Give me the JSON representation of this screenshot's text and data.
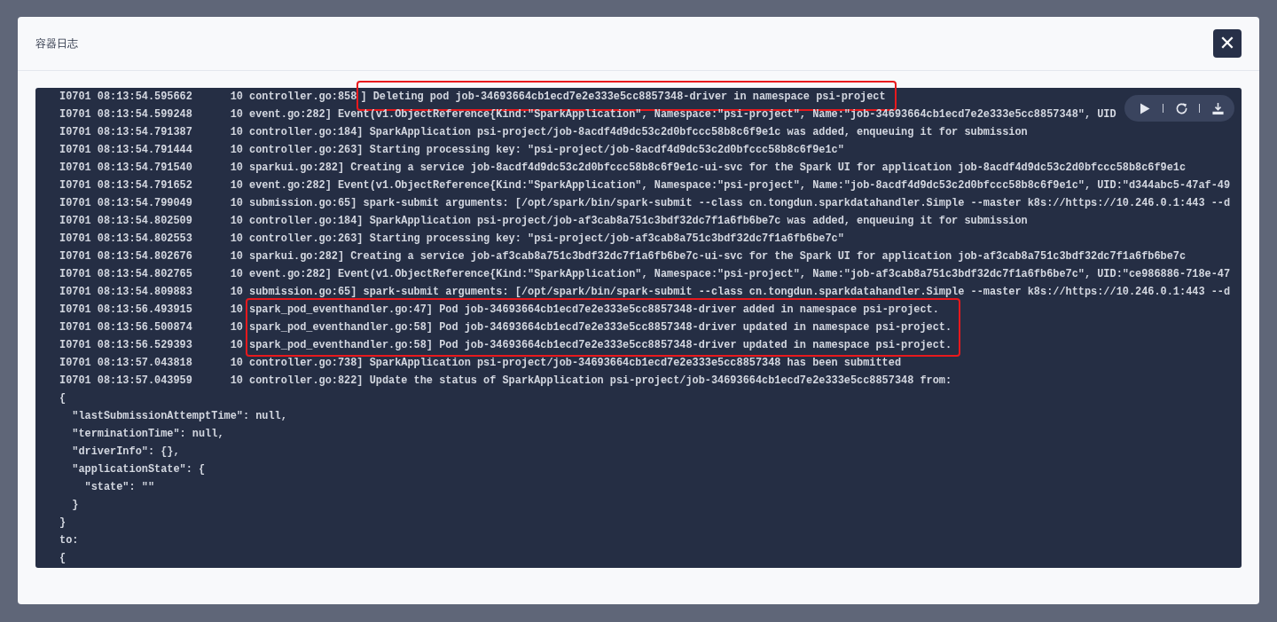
{
  "dialog": {
    "title": "容器日志",
    "close_label": "✕"
  },
  "log": [
    {
      "kind": "marked_line",
      "prefix": "I0701 08:13:54.595662      10 controller.go:858",
      "marked": "] Deleting pod job-34693664cb1ecd7e2e333e5cc8857348-driver in namespace psi-project"
    },
    {
      "kind": "line",
      "text": "I0701 08:13:54.599248      10 event.go:282] Event(v1.ObjectReference{Kind:\"SparkApplication\", Namespace:\"psi-project\", Name:\"job-34693664cb1ecd7e2e333e5cc8857348\", UID"
    },
    {
      "kind": "line",
      "text": "I0701 08:13:54.791387      10 controller.go:184] SparkApplication psi-project/job-8acdf4d9dc53c2d0bfccc58b8c6f9e1c was added, enqueuing it for submission"
    },
    {
      "kind": "line",
      "text": "I0701 08:13:54.791444      10 controller.go:263] Starting processing key: \"psi-project/job-8acdf4d9dc53c2d0bfccc58b8c6f9e1c\""
    },
    {
      "kind": "line",
      "text": "I0701 08:13:54.791540      10 sparkui.go:282] Creating a service job-8acdf4d9dc53c2d0bfccc58b8c6f9e1c-ui-svc for the Spark UI for application job-8acdf4d9dc53c2d0bfccc58b8c6f9e1c"
    },
    {
      "kind": "line",
      "text": "I0701 08:13:54.791652      10 event.go:282] Event(v1.ObjectReference{Kind:\"SparkApplication\", Namespace:\"psi-project\", Name:\"job-8acdf4d9dc53c2d0bfccc58b8c6f9e1c\", UID:\"d344abc5-47af-49"
    },
    {
      "kind": "line",
      "text": "I0701 08:13:54.799049      10 submission.go:65] spark-submit arguments: [/opt/spark/bin/spark-submit --class cn.tongdun.sparkdatahandler.Simple --master k8s://https://10.246.0.1:443 --d"
    },
    {
      "kind": "line",
      "text": "I0701 08:13:54.802509      10 controller.go:184] SparkApplication psi-project/job-af3cab8a751c3bdf32dc7f1a6fb6be7c was added, enqueuing it for submission"
    },
    {
      "kind": "line",
      "text": "I0701 08:13:54.802553      10 controller.go:263] Starting processing key: \"psi-project/job-af3cab8a751c3bdf32dc7f1a6fb6be7c\""
    },
    {
      "kind": "line",
      "text": "I0701 08:13:54.802676      10 sparkui.go:282] Creating a service job-af3cab8a751c3bdf32dc7f1a6fb6be7c-ui-svc for the Spark UI for application job-af3cab8a751c3bdf32dc7f1a6fb6be7c"
    },
    {
      "kind": "line",
      "text": "I0701 08:13:54.802765      10 event.go:282] Event(v1.ObjectReference{Kind:\"SparkApplication\", Namespace:\"psi-project\", Name:\"job-af3cab8a751c3bdf32dc7f1a6fb6be7c\", UID:\"ce986886-718e-47"
    },
    {
      "kind": "line",
      "text": "I0701 08:13:54.809883      10 submission.go:65] spark-submit arguments: [/opt/spark/bin/spark-submit --class cn.tongdun.sparkdatahandler.Simple --master k8s://https://10.246.0.1:443 --d"
    },
    {
      "kind": "marked_group",
      "lines": [
        {
          "prefix": "I0701 08:13:56.493915      10 ",
          "marked": "spark_pod_eventhandler.go:47] Pod job-34693664cb1ecd7e2e333e5cc8857348-driver added in namespace psi-project."
        },
        {
          "prefix": "I0701 08:13:56.500874      10 ",
          "marked": "spark_pod_eventhandler.go:58] Pod job-34693664cb1ecd7e2e333e5cc8857348-driver updated in namespace psi-project."
        },
        {
          "prefix": "I0701 08:13:56.529393      10 ",
          "marked": "spark_pod_eventhandler.go:58] Pod job-34693664cb1ecd7e2e333e5cc8857348-driver updated in namespace psi-project."
        }
      ]
    },
    {
      "kind": "line",
      "text": "I0701 08:13:57.043818      10 controller.go:738] SparkApplication psi-project/job-34693664cb1ecd7e2e333e5cc8857348 has been submitted"
    },
    {
      "kind": "line",
      "text": "I0701 08:13:57.043959      10 controller.go:822] Update the status of SparkApplication psi-project/job-34693664cb1ecd7e2e333e5cc8857348 from:"
    },
    {
      "kind": "line",
      "text": "{"
    },
    {
      "kind": "line",
      "text": "  \"lastSubmissionAttemptTime\": null,"
    },
    {
      "kind": "line",
      "text": "  \"terminationTime\": null,"
    },
    {
      "kind": "line",
      "text": "  \"driverInfo\": {},"
    },
    {
      "kind": "line",
      "text": "  \"applicationState\": {"
    },
    {
      "kind": "line",
      "text": "    \"state\": \"\""
    },
    {
      "kind": "line",
      "text": "  }"
    },
    {
      "kind": "line",
      "text": "}"
    },
    {
      "kind": "line",
      "text": "to:"
    },
    {
      "kind": "line",
      "text": "{"
    }
  ]
}
